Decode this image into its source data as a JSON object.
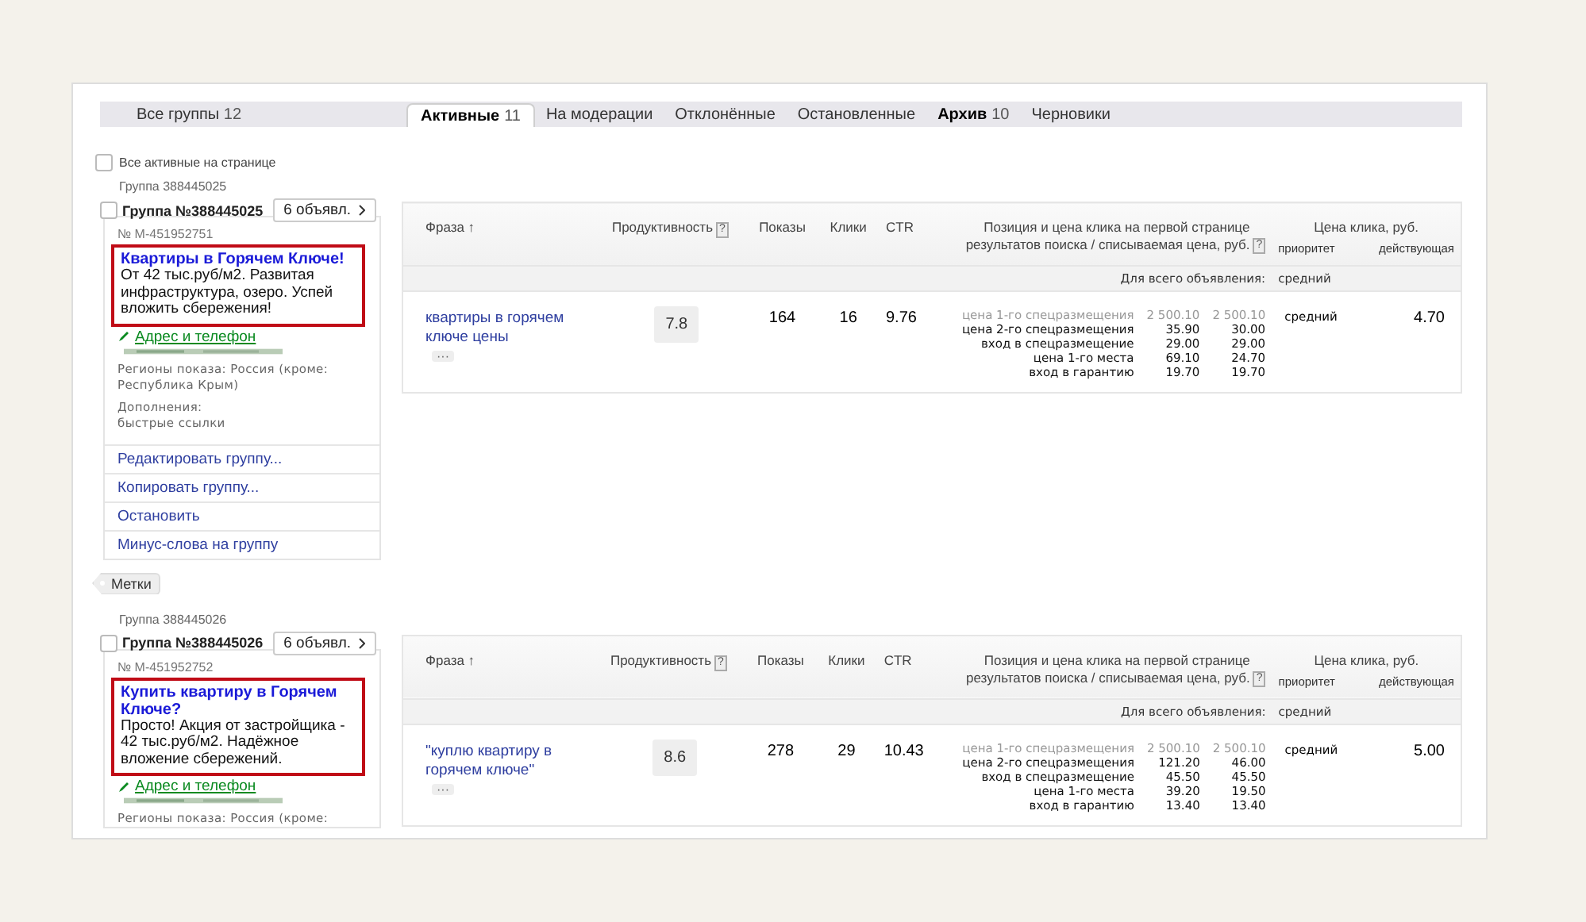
{
  "all_groups": {
    "label": "Все группы",
    "count": "12"
  },
  "tabs": [
    {
      "label": "Активные",
      "count": "11",
      "selected": true,
      "emphasized": true
    },
    {
      "label": "На модерации",
      "selected": false,
      "emphasized": false
    },
    {
      "label": "Отклонённые",
      "selected": false,
      "emphasized": false
    },
    {
      "label": "Остановленные",
      "selected": false,
      "emphasized": false
    },
    {
      "label": "Архив",
      "count": "10",
      "selected": false,
      "emphasized": true
    },
    {
      "label": "Черновики",
      "selected": false,
      "emphasized": false
    }
  ],
  "select_all": {
    "label": "Все активные на странице",
    "checked": false
  },
  "groups": [
    {
      "caption": "Группа 388445025",
      "name": "Группа №388445025",
      "checked": false,
      "ads_button": "6 объявл.",
      "ad_number": "№ M-451952751",
      "ad_title": "Квартиры в Горячем Ключе!",
      "ad_text": "От 42 тыс.руб/м2. Развитая инфраструктура, озеро. Успей вложить сбережения!",
      "contact_link": "Адрес и телефон",
      "regions": "Регионы показа: Россия (кроме: Республика Крым)",
      "extras_label": "Дополнения:",
      "extras": "быстрые ссылки",
      "actions": [
        "Редактировать группу...",
        "Копировать группу...",
        "Остановить",
        "Минус-слова на группу"
      ],
      "tags_button": "Метки",
      "table": {
        "columns": [
          {
            "label": "Фраза ↑"
          },
          {
            "label": "Продуктивность",
            "hint": "?"
          },
          {
            "label": "Показы"
          },
          {
            "label": "Клики"
          },
          {
            "label": "CTR"
          },
          {
            "label": "Позиция и цена клика на первой странице результатов поиска / списываемая цена, руб.",
            "hint": "?"
          },
          {
            "label": "Цена клика, руб.",
            "sub": [
              "приоритет",
              "действующая"
            ]
          }
        ],
        "whole_ad_label": "Для всего объявления:",
        "whole_ad_priority": "средний",
        "rows": [
          {
            "phrase": "квартиры в горячем ключе цены",
            "more": "···",
            "productivity": "7.8",
            "shows": "164",
            "clicks": "16",
            "ctr": "9.76",
            "positions": [
              {
                "label": "цена 1-го спецразмещения",
                "bid": "2 500.10",
                "charged": "2 500.10",
                "muted": true
              },
              {
                "label": "цена 2-го спецразмещения",
                "bid": "35.90",
                "charged": "30.00",
                "muted": false
              },
              {
                "label": "вход в спецразмещение",
                "bid": "29.00",
                "charged": "29.00",
                "muted": false
              },
              {
                "label": "цена 1-го места",
                "bid": "69.10",
                "charged": "24.70",
                "muted": false
              },
              {
                "label": "вход в гарантию",
                "bid": "19.70",
                "charged": "19.70",
                "muted": false
              }
            ],
            "priority": "средний",
            "price": "4.70"
          }
        ]
      }
    },
    {
      "caption": "Группа 388445026",
      "name": "Группа №388445026",
      "checked": false,
      "ads_button": "6 объявл.",
      "ad_number": "№ M-451952752",
      "ad_title": "Купить квартиру в Горячем Ключе?",
      "ad_text": "Просто! Акция от застройщика - 42 тыс.руб/м2. Надёжное вложение сбережений.",
      "contact_link": "Адрес и телефон",
      "regions": "Регионы показа: Россия (кроме:",
      "table": {
        "columns": [
          {
            "label": "Фраза ↑"
          },
          {
            "label": "Продуктивность",
            "hint": "?"
          },
          {
            "label": "Показы"
          },
          {
            "label": "Клики"
          },
          {
            "label": "CTR"
          },
          {
            "label": "Позиция и цена клика на первой странице результатов поиска / списываемая цена, руб.",
            "hint": "?"
          },
          {
            "label": "Цена клика, руб.",
            "sub": [
              "приоритет",
              "действующая"
            ]
          }
        ],
        "whole_ad_label": "Для всего объявления:",
        "whole_ad_priority": "средний",
        "rows": [
          {
            "phrase": "\"куплю квартиру в горячем ключе\"",
            "more": "···",
            "productivity": "8.6",
            "shows": "278",
            "clicks": "29",
            "ctr": "10.43",
            "positions": [
              {
                "label": "цена 1-го спецразмещения",
                "bid": "2 500.10",
                "charged": "2 500.10",
                "muted": true
              },
              {
                "label": "цена 2-го спецразмещения",
                "bid": "121.20",
                "charged": "46.00",
                "muted": false
              },
              {
                "label": "вход в спецразмещение",
                "bid": "45.50",
                "charged": "45.50",
                "muted": false
              },
              {
                "label": "цена 1-го места",
                "bid": "39.20",
                "charged": "19.50",
                "muted": false
              },
              {
                "label": "вход в гарантию",
                "bid": "13.40",
                "charged": "13.40",
                "muted": false
              }
            ],
            "priority": "средний",
            "price": "5.00"
          }
        ]
      }
    }
  ]
}
